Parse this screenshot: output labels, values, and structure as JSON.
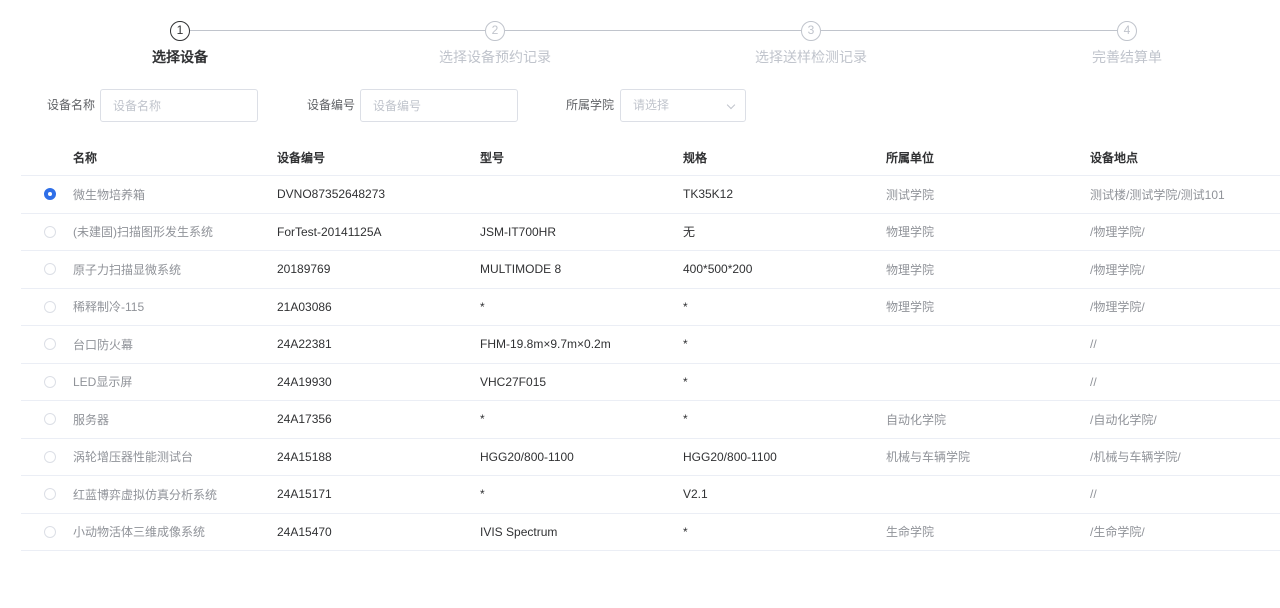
{
  "steps": [
    {
      "number": "1",
      "title": "选择设备",
      "active": true
    },
    {
      "number": "2",
      "title": "选择设备预约记录",
      "active": false
    },
    {
      "number": "3",
      "title": "选择送样检测记录",
      "active": false
    },
    {
      "number": "4",
      "title": "完善结算单",
      "active": false
    }
  ],
  "filters": {
    "device_name_label": "设备名称",
    "device_name_placeholder": "设备名称",
    "device_code_label": "设备编号",
    "device_code_placeholder": "设备编号",
    "college_label": "所属学院",
    "college_placeholder": "请选择"
  },
  "table": {
    "columns": [
      "名称",
      "设备编号",
      "型号",
      "规格",
      "所属单位",
      "设备地点"
    ],
    "rows": [
      {
        "selected": true,
        "name": "微生物培养箱",
        "code": "DVNO87352648273",
        "model": "",
        "spec": "TK35K12",
        "unit": "测试学院",
        "location": "测试楼/测试学院/测试101"
      },
      {
        "selected": false,
        "name": "(未建固)扫描图形发生系统",
        "code": "ForTest-20141125A",
        "model": "JSM-IT700HR",
        "spec": "无",
        "unit": "物理学院",
        "location": "/物理学院/"
      },
      {
        "selected": false,
        "name": "原子力扫描显微系统",
        "code": "20189769",
        "model": "MULTIMODE 8",
        "spec": "400*500*200",
        "unit": "物理学院",
        "location": "/物理学院/"
      },
      {
        "selected": false,
        "name": "稀释制冷-115",
        "code": "21A03086",
        "model": "*",
        "spec": "*",
        "unit": "物理学院",
        "location": "/物理学院/"
      },
      {
        "selected": false,
        "name": "台口防火幕",
        "code": "24A22381",
        "model": "FHM-19.8m×9.7m×0.2m",
        "spec": "*",
        "unit": "",
        "location": "//"
      },
      {
        "selected": false,
        "name": "LED显示屏",
        "code": "24A19930",
        "model": "VHC27F015",
        "spec": "*",
        "unit": "",
        "location": "//"
      },
      {
        "selected": false,
        "name": "服务器",
        "code": "24A17356",
        "model": "*",
        "spec": "*",
        "unit": "自动化学院",
        "location": "/自动化学院/"
      },
      {
        "selected": false,
        "name": "涡轮增压器性能测试台",
        "code": "24A15188",
        "model": "HGG20/800-1100",
        "spec": "HGG20/800-1100",
        "unit": "机械与车辆学院",
        "location": "/机械与车辆学院/"
      },
      {
        "selected": false,
        "name": "红蓝博弈虚拟仿真分析系统",
        "code": "24A15171",
        "model": "*",
        "spec": "V2.1",
        "unit": "",
        "location": "//"
      },
      {
        "selected": false,
        "name": "小动物活体三维成像系统",
        "code": "24A15470",
        "model": "IVIS Spectrum",
        "spec": "*",
        "unit": "生命学院",
        "location": "/生命学院/"
      }
    ]
  },
  "colors": {
    "accent": "#2f6fe8",
    "border": "#ebeef5",
    "muted_text": "#909399"
  }
}
